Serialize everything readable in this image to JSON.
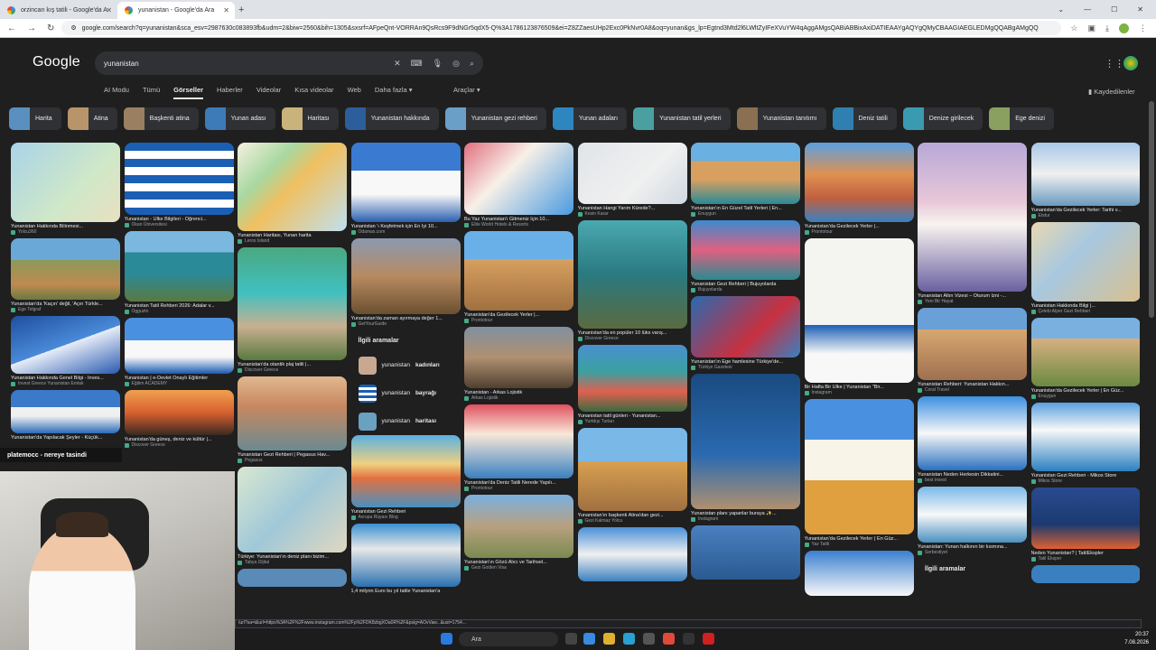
{
  "browser": {
    "tabs": [
      {
        "title": "orzincan kış tatili - Google'da A"
      },
      {
        "title": "yunanistan - Google'da Ara"
      }
    ],
    "url": "google.com/search?q=yunanistan&sca_esv=2987630c083893fb&udm=2&biw=2560&bih=1305&sxsrf=AFpeQnt-VORRAn9QsRcs9F9dNGr5qdX5-Q%3A1786123876509&ei=Z8ZZaesUHp2Exc0PkNvr0A8&oq=yunan&gs_lp=Egtnd3Mtd2l6LWltZyIFeXVuYW4qAggAMgsQABiABBixAxiDATIEAAYgAQYgQMyCBAAGIAEGLEDMgQQABgAMgQQ"
  },
  "google": {
    "logo": "Google",
    "query": "yunanistan",
    "tabs": [
      "AI Modu",
      "Tümü",
      "Görseller",
      "Haberler",
      "Videolar",
      "Kısa videolar",
      "Web",
      "Daha fazla"
    ],
    "selected_tab": "Görseller",
    "tools": "Araçlar",
    "saved": "Kaydedilenler"
  },
  "chips": [
    {
      "label": "Harita",
      "color": "#5a8fc0"
    },
    {
      "label": "Atina",
      "color": "#b8946a"
    },
    {
      "label": "Başkenti atina",
      "color": "#9a8060"
    },
    {
      "label": "Yunan adası",
      "color": "#3d7bb8"
    },
    {
      "label": "Haritası",
      "color": "#c9b37a"
    },
    {
      "label": "Yunanistan hakkında",
      "color": "#2b5e9a"
    },
    {
      "label": "Yunanistan gezi rehberi",
      "color": "#6a9fc8"
    },
    {
      "label": "Yunan adaları",
      "color": "#2e86c1"
    },
    {
      "label": "Yunanistan tatil yerleri",
      "color": "#4aa0a0"
    },
    {
      "label": "Yunanistan tanıtımı",
      "color": "#8a7050"
    },
    {
      "label": "Deniz tatili",
      "color": "#2f80b0"
    },
    {
      "label": "Denize girilecek",
      "color": "#3a9ab0"
    },
    {
      "label": "Ege denizi",
      "color": "#8aa060"
    }
  ],
  "columns": [
    [
      {
        "h": 88,
        "bg": "linear-gradient(135deg,#a9d3e8,#cfe8c8 60%,#e8e0c0)",
        "cap": "Yunanistan Hakkında Bilinmesi...",
        "src": "Yolcu360"
      },
      {
        "h": 68,
        "bg": "linear-gradient(#6aa8d8 0 35%,#8a9a5a 35%,#c08a50 75%,#6a7a40)",
        "cap": "Yunanistan'da 'Kaçın' değil, 'Açın Türkle...",
        "src": "Ege Telgraf"
      },
      {
        "h": 64,
        "bg": "linear-gradient(160deg,#1e4fa0,#4a8ad8 50%,#e8eef8 50%,#2a5ab0)",
        "cap": "Yunanistan Hakkında Genel Bilgi - Inves...",
        "src": "Invest Greece Yunanistan Emlak"
      },
      {
        "h": 48,
        "bg": "linear-gradient(#3a7ac8 0 40%,#f0f0f0 40% 60%,#2a6ab8)",
        "cap": "Yunanistan'da Yapılacak Şeyler - Küçük...",
        "src": ""
      }
    ],
    [
      {
        "h": 80,
        "bg": "repeating-linear-gradient(#1b5fb5 0 9px,#ffffff 9px 18px)",
        "cap": "Yunanistan - Ülke Bilgileri - Öğrenci...",
        "src": "Okan Üniversitesi"
      },
      {
        "h": 78,
        "bg": "linear-gradient(#7ab8e0 0 30%,#2a8a98 30% 60%,#5a7a40)",
        "cap": "Yunanistan Tatil Rehberi 2026: Adalar v...",
        "src": "Ogguzto"
      },
      {
        "h": 62,
        "bg": "linear-gradient(#4a90e0 0 40%,#f8f8f8 40% 70%,#1a5ab0)",
        "cap": "Yunanistan | e-Devlet Onaylı Eğitimler",
        "src": "Eğitim ACADEMY"
      },
      {
        "h": 50,
        "bg": "linear-gradient(#f0a050,#d86030 50%,#3a2a20)",
        "cap": "Yunanistan'da güneş, deniz ve kültür |...",
        "src": "Discover Greece"
      }
    ],
    [
      {
        "h": 98,
        "bg": "linear-gradient(135deg,#f4f0e0,#a8d8a0 30%,#f0c060 50%,#c0e0f0)",
        "cap": "Yunanistan Haritası, Yunan harita",
        "src": "Leros Island"
      },
      {
        "h": 125,
        "bg": "linear-gradient(#4aa880,#40c0c0 40%,#c8b090 70%,#5a7a40)",
        "cap": "Yunanistan'da otantik plaj tatili |...",
        "src": "Discover Greece"
      },
      {
        "h": 82,
        "bg": "linear-gradient(#e0b890,#c88860 40%,#6a8a90)",
        "cap": "Yunanistan Gezi Rehberi | Pegasus Hav...",
        "src": "Pegasus"
      },
      {
        "h": 95,
        "bg": "linear-gradient(135deg,#d8e8d0,#a0c8d8 50%,#e0d8c0)",
        "cap": "Türkiye: Yunanistan'ın deniz planı bizim...",
        "src": "Tabya Dijital"
      },
      {
        "h": 20,
        "bg": "#5a8ab8",
        "cap": "",
        "src": ""
      }
    ],
    [
      {
        "h": 88,
        "bg": "linear-gradient(#3a7ad0 0 35%,#f8f8f8 35% 65%,#2a60b0)",
        "cap": "Yunanistan 'ı Keşfetmek için En İyi 10...",
        "src": "Odamax.com"
      },
      {
        "h": 84,
        "bg": "linear-gradient(#8a9ab0,#b88a60 50%,#6a5030)",
        "cap": "Yunanistan'da zaman ayırmaya değer 1...",
        "src": "GetYourGuide"
      },
      {
        "related": true
      },
      {
        "h": 80,
        "bg": "linear-gradient(#5ab0e0,#f0d080 40%,#e07040 60%,#4a90c0)",
        "cap": "Yunanistan Gezi Rehberi",
        "src": "Avrupa Rüyası Blog"
      },
      {
        "h": 70,
        "bg": "linear-gradient(#3a90d0,#e8e8e8 40%,#2a70b0)",
        "cap": "1,4 milyon Euro bu yıl tatile Yunanistan'a",
        "src": ""
      }
    ],
    [
      {
        "h": 80,
        "bg": "linear-gradient(135deg,#e07080,#f8f0e8 40%,#4a9ae0)",
        "cap": "Bu Yaz Yunanistan'ı Gitmeniz İçin 10...",
        "src": "Elite World Hotels & Resorts"
      },
      {
        "h": 88,
        "bg": "linear-gradient(#6ab0e8 0 35%,#d8a060 35%,#a07040)",
        "cap": "Yunanistan'da Gezilecek Yerler |...",
        "src": "Prontotour"
      },
      {
        "h": 68,
        "bg": "linear-gradient(#8090a0,#b09070 50%,#504030)",
        "cap": "Yunanistan - Arkas Lojistik",
        "src": "Arkas Lojistik"
      },
      {
        "h": 82,
        "bg": "linear-gradient(#e05060,#f8e8d8 40%,#3a80c0)",
        "cap": "Yunanistan'da Deniz Tatili Nerede Yapılı...",
        "src": "Prontotour"
      },
      {
        "h": 70,
        "bg": "linear-gradient(#7ab0e0,#b8a080 50%,#7a8a50)",
        "cap": "Yunanistan'ın Gözü Alıcı ve Tarihsel...",
        "src": "Gezi Golden Visa"
      }
    ],
    [
      {
        "h": 68,
        "bg": "linear-gradient(135deg,#e0e4e8,#f0f0f0 60%,#d0d8e0)",
        "cap": "Yunanistan Hangi Yarım Kürede?...",
        "src": "Kesin Karar"
      },
      {
        "h": 120,
        "bg": "linear-gradient(#4aa8b0,#2a7a80 50%,#5a6a40)",
        "cap": "Yunanistan'da en popüler 10 lüks varış...",
        "src": "Discover Greece"
      },
      {
        "h": 74,
        "bg": "linear-gradient(#4a90d0,#3aa0a0 40%,#e06050 70%,#3a6a40)",
        "cap": "Yunanistan tatil günleri - Yunanistan...",
        "src": "Yurtdışı Turları"
      },
      {
        "h": 92,
        "bg": "linear-gradient(#7ab8e8 0 40%,#d8a050 40%,#a07040)",
        "cap": "Yunanistan'ın başkenti Atina'dan gezi...",
        "src": "Gezi Kalmaz Yolcu"
      },
      {
        "h": 60,
        "bg": "linear-gradient(#4a90d8,#f0f0f0 50%,#3a80c0)",
        "cap": "",
        "src": ""
      }
    ],
    [
      {
        "h": 68,
        "bg": "linear-gradient(#6ab0e0 0 30%,#d8a060 30% 60%,#2a8a98)",
        "cap": "Yunanistan'ın En Güzel Tatil Yerleri | En...",
        "src": "Enuygun"
      },
      {
        "h": 66,
        "bg": "linear-gradient(#3a8ad0,#e06080 50%,#2a8a90)",
        "cap": "Yunanistan Gezi Rehberi | Bujuyolarda",
        "src": "Bujuyolarda"
      },
      {
        "h": 68,
        "bg": "linear-gradient(135deg,#2a6ab0,#c83040 60%,#3a80c0)",
        "cap": "Yunanistan'ın Ege hamlesine Türkiye'de...",
        "src": "Türkiye Gazetesi"
      },
      {
        "h": 150,
        "bg": "linear-gradient(#1a4a80,#2a6ab0 60%,#b09070)",
        "cap": "Yunanistan planı yapanlar buraya ✨...",
        "src": "Instagram"
      },
      {
        "h": 60,
        "bg": "linear-gradient(#4a80c0,#2a5a90)",
        "cap": "",
        "src": ""
      }
    ],
    [
      {
        "h": 88,
        "bg": "linear-gradient(#5aa0e0,#e09050 40%,#c06040 70%,#3a80c0)",
        "cap": "Yunanistan'da Gezilecek Yerler |...",
        "src": "Prontotour"
      },
      {
        "h": 160,
        "bg": "linear-gradient(#f4f4f0 0 60%,#1b5fb5 60%,#f8f8f8 80%)",
        "cap": "Bir Hafta Bir Ülke | Yunanistan \"Bir...",
        "src": "Instagram"
      },
      {
        "h": 150,
        "bg": "linear-gradient(#4a90e0 0 30%,#f8f4e8 30% 60%,#e0a040 60%)",
        "cap": "Yunanistan'da Gezilecek Yerler ( En Güz...",
        "src": "Yaz Tatili"
      },
      {
        "h": 50,
        "bg": "linear-gradient(#3a80d0,#f8f8f8)",
        "cap": "",
        "src": ""
      }
    ],
    [
      {
        "h": 165,
        "bg": "linear-gradient(#b8a8d8,#e8c8d8 40%,#f8f4f0 55%,#6a60a0)",
        "cap": "Yunanistan Altın Vizesi – Oturum İzni -...",
        "src": "Yeni Bir Hayat"
      },
      {
        "h": 80,
        "bg": "linear-gradient(#6aa0d8 0 30%,#d8a870 30%,#a07050)",
        "cap": "Yunanistan Rehberi: Yunanistan Hakkın...",
        "src": "Coral Travel"
      },
      {
        "h": 82,
        "bg": "linear-gradient(#3a90e0,#f8f8f8 50%,#2a70c0)",
        "cap": "Yunanistan Neden Herkesin Dikkatini...",
        "src": "best invest"
      },
      {
        "h": 62,
        "bg": "linear-gradient(#7ab8e8,#f8f8f8 50%,#4a90c0)",
        "cap": "Yunanistan: Yunan halkının bir kısmına...",
        "src": "Serbestiyet"
      },
      {
        "related2": true
      }
    ],
    [
      {
        "h": 70,
        "bg": "linear-gradient(#a8c8e8,#f0f0f0 50%,#6a9ac0)",
        "cap": "Yunanistan'da Gezilecek Yerler: Tarihi v...",
        "src": "Etstur"
      },
      {
        "h": 88,
        "bg": "linear-gradient(135deg,#e8d8b0,#a8c8e0 40%,#d8c090)",
        "cap": "Yunanistan Hakkında Bilgi |...",
        "src": "Çelebi Alper Gezi Rehberi"
      },
      {
        "h": 76,
        "bg": "linear-gradient(#7ab0e0 0 30%,#d8b080 30%,#6a8a40)",
        "cap": "Yunanistan'da Gezilecek Yerler | En Güz...",
        "src": "Enuygun"
      },
      {
        "h": 76,
        "bg": "linear-gradient(#5aa0e0,#f8f8f8 40%,#2a80c0)",
        "cap": "Yunanistan Gezi Rehberi - Mikos Store",
        "src": "Mikos Store"
      },
      {
        "h": 68,
        "bg": "linear-gradient(#2a4a90,#1a3a70 60%,#e06030)",
        "cap": "Neden Yunanistan? | TatilEkspler",
        "src": "Tatil Eksper"
      },
      {
        "h": 20,
        "bg": "#3a80c0",
        "cap": "",
        "src": ""
      }
    ]
  ],
  "related": {
    "title": "İlgili aramalar",
    "items": [
      {
        "prefix": "yunanistan",
        "bold": "kadınları"
      },
      {
        "prefix": "yunanistan",
        "bold": "bayrağı"
      },
      {
        "prefix": "yunanistan",
        "bold": "haritası"
      }
    ]
  },
  "related2_title": "İlgili aramalar",
  "overlay_banner": "platemocc - nereye tasindi",
  "status_url": "/url?sa=i&url=https%3A%2F%2Fwww.instagram.com%2Fp%2FDK8zbgXOa0R%2F&psig=AOvVaw...&ust=1754...",
  "taskbar": {
    "search_label": "Ara",
    "time": "20:37",
    "date": "7.08.2026"
  }
}
